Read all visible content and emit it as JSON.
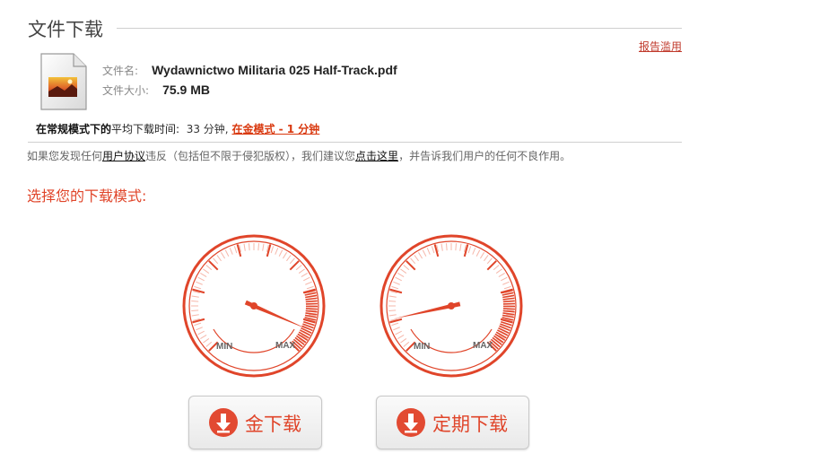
{
  "header": {
    "title": "文件下载",
    "report_label": "报告滥用"
  },
  "file": {
    "name_label": "文件名:",
    "name": "Wydawnictwo Militaria 025 Half-Track.pdf",
    "size_label": "文件大小:",
    "size": "75.9 MB"
  },
  "download_time": {
    "label_bold": "在常规模式下的",
    "label_rest": "平均下载时间:",
    "regular_time": "33 分钟,",
    "gold_link": "在金模式 - 1 分钟"
  },
  "notice": {
    "prefix": "如果您发现任何",
    "terms_link": "用户协议",
    "middle": "违反（包括但不限于侵犯版权），我们建议您",
    "click_link": "点击这里",
    "suffix": "，并告诉我们用户的任何不良作用。"
  },
  "choose_mode": "选择您的下载模式:",
  "gauges": [
    {
      "min_label": "MIN",
      "max_label": "MAX",
      "level": 0.92
    },
    {
      "min_label": "MIN",
      "max_label": "MAX",
      "level": 0.12
    }
  ],
  "buttons": {
    "gold_label": "金下载",
    "scheduled_label": "定期下载"
  },
  "colors": {
    "accent": "#e0452a",
    "link_red": "#c0392b"
  },
  "icons": {
    "file": "pdf-file-icon",
    "download": "download-arrow-icon"
  }
}
